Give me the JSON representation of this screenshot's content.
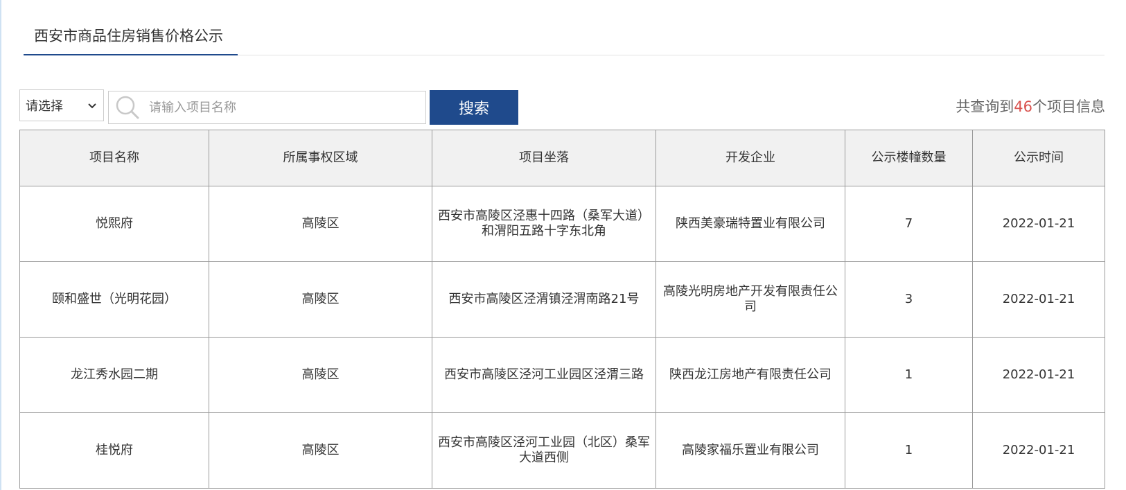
{
  "tab": {
    "title": "西安市商品住房销售价格公示"
  },
  "filter": {
    "select_label": "请选择"
  },
  "search": {
    "placeholder": "请输入项目名称",
    "button_label": "搜索"
  },
  "result": {
    "prefix": "共查询到",
    "count": "46",
    "suffix": "个项目信息"
  },
  "table": {
    "headers": [
      "项目名称",
      "所属事权区域",
      "项目坐落",
      "开发企业",
      "公示楼幢数量",
      "公示时间"
    ],
    "rows": [
      [
        "悦熙府",
        "高陵区",
        "西安市高陵区泾惠十四路（桑军大道）和渭阳五路十字东北角",
        "陕西美豪瑞特置业有限公司",
        "7",
        "2022-01-21"
      ],
      [
        "颐和盛世（光明花园）",
        "高陵区",
        "西安市高陵区泾渭镇泾渭南路21号",
        "高陵光明房地产开发有限责任公司",
        "3",
        "2022-01-21"
      ],
      [
        "龙江秀水园二期",
        "高陵区",
        "西安市高陵区泾河工业园区泾渭三路",
        "陕西龙江房地产有限责任公司",
        "1",
        "2022-01-21"
      ],
      [
        "桂悦府",
        "高陵区",
        "西安市高陵区泾河工业园（北区）桑军大道西侧",
        "高陵家福乐置业有限公司",
        "1",
        "2022-01-21"
      ]
    ]
  },
  "colors": {
    "accent": "#1f4a8c",
    "count_highlight": "#d9534f",
    "header_bg": "#f1f1f1",
    "border": "#999999"
  }
}
